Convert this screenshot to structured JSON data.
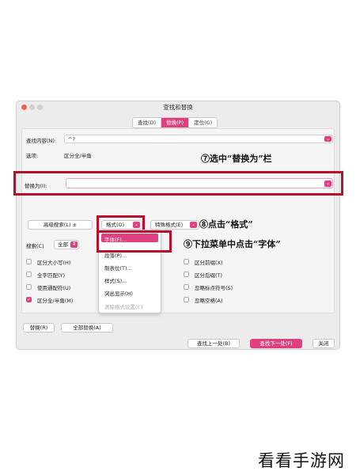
{
  "window": {
    "title": "查找和替换"
  },
  "tabs": [
    {
      "label": "查找(D)",
      "active": false
    },
    {
      "label": "替换(P)",
      "active": true
    },
    {
      "label": "定位(G)",
      "active": false
    }
  ],
  "find": {
    "label": "查找内容(N):",
    "value": "^?"
  },
  "options": {
    "label": "选项:",
    "value": "区分全/半角"
  },
  "replace": {
    "label": "替换为(I):",
    "value": ""
  },
  "buttons": {
    "more": "高级搜索(L) ±",
    "format": "格式(O)",
    "special": "特殊格式(E)",
    "replace": "替换(R)",
    "replace_all": "全部替换(A)",
    "find_prev": "查找上一处(B)",
    "find_next": "查找下一处(F)",
    "close": "关闭"
  },
  "search": {
    "label": "搜索(C)",
    "value": "全部"
  },
  "checks_left": [
    {
      "label": "区分大小写(H)",
      "checked": false
    },
    {
      "label": "全字匹配(Y)",
      "checked": false
    },
    {
      "label": "使用通配符(U)",
      "checked": false
    },
    {
      "label": "区分全/半角(M)",
      "checked": true
    }
  ],
  "checks_right": [
    {
      "label": "区分前缀(X)",
      "checked": false
    },
    {
      "label": "区分后缀(T)",
      "checked": false
    },
    {
      "label": "忽略标点符号(S)",
      "checked": false
    },
    {
      "label": "忽略空格(A)",
      "checked": false
    }
  ],
  "format_menu": [
    {
      "label": "字体(F)...",
      "highlighted": true,
      "disabled": false
    },
    {
      "label": "段落(P)...",
      "highlighted": false,
      "disabled": false
    },
    {
      "label": "制表位(T)...",
      "highlighted": false,
      "disabled": false
    },
    {
      "label": "样式(S)...",
      "highlighted": false,
      "disabled": false
    },
    {
      "label": "突出显示(H)",
      "highlighted": false,
      "disabled": false
    },
    {
      "label": "清除格式设置(C)",
      "highlighted": false,
      "disabled": true
    }
  ],
  "annotations": {
    "step7": "⑦选中“替换为”栏",
    "step8": "⑧点击“格式”",
    "step9": "⑨下拉菜单中点击“字体”"
  },
  "watermark": "看看手游网",
  "colors": {
    "accent": "#e0407f",
    "highlight_box": "#b8102a",
    "window_bg": "#ececec"
  }
}
